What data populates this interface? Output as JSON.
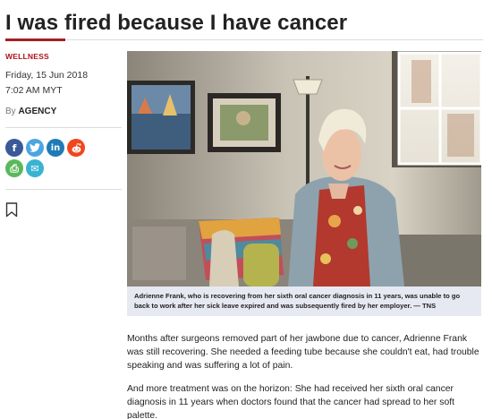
{
  "article": {
    "title": "I was fired because I have cancer",
    "category": "WELLNESS",
    "date": "Friday, 15 Jun 2018",
    "time": "7:02 AM MYT",
    "byline_prefix": "By",
    "author": "AGENCY",
    "caption": "Adrienne Frank, who is recovering from her sixth oral cancer diagnosis in 11 years, was unable to go back to work after her sick leave expired and was subsequently fired by her employer. — TNS",
    "paragraphs": [
      "Months after surgeons removed part of her jawbone due to cancer, Adrienne Frank was still recovering. She needed a feeding tube because she couldn't eat, had trouble speaking and was suffering a lot of pain.",
      "And more treatment was on the horizon: She had received her sixth oral cancer diagnosis in 11 years when doctors found that the cancer had spread to her soft palette."
    ]
  },
  "share": {
    "facebook": {
      "icon": "facebook-icon",
      "glyph": "f",
      "color": "#3b5998"
    },
    "twitter": {
      "icon": "twitter-icon",
      "glyph": "t",
      "color": "#4ba5e0"
    },
    "linkedin": {
      "icon": "linkedin-icon",
      "glyph": "in",
      "color": "#1f7bb6"
    },
    "reddit": {
      "icon": "reddit-icon",
      "glyph": "r",
      "color": "#f0471d"
    },
    "print": {
      "icon": "print-icon",
      "glyph": "⎙",
      "color": "#5bb85b"
    },
    "email": {
      "icon": "email-icon",
      "glyph": "✉",
      "color": "#3ab3d3"
    }
  },
  "colors": {
    "accent": "#a51e22",
    "caption_bg": "#e6e9f1"
  }
}
